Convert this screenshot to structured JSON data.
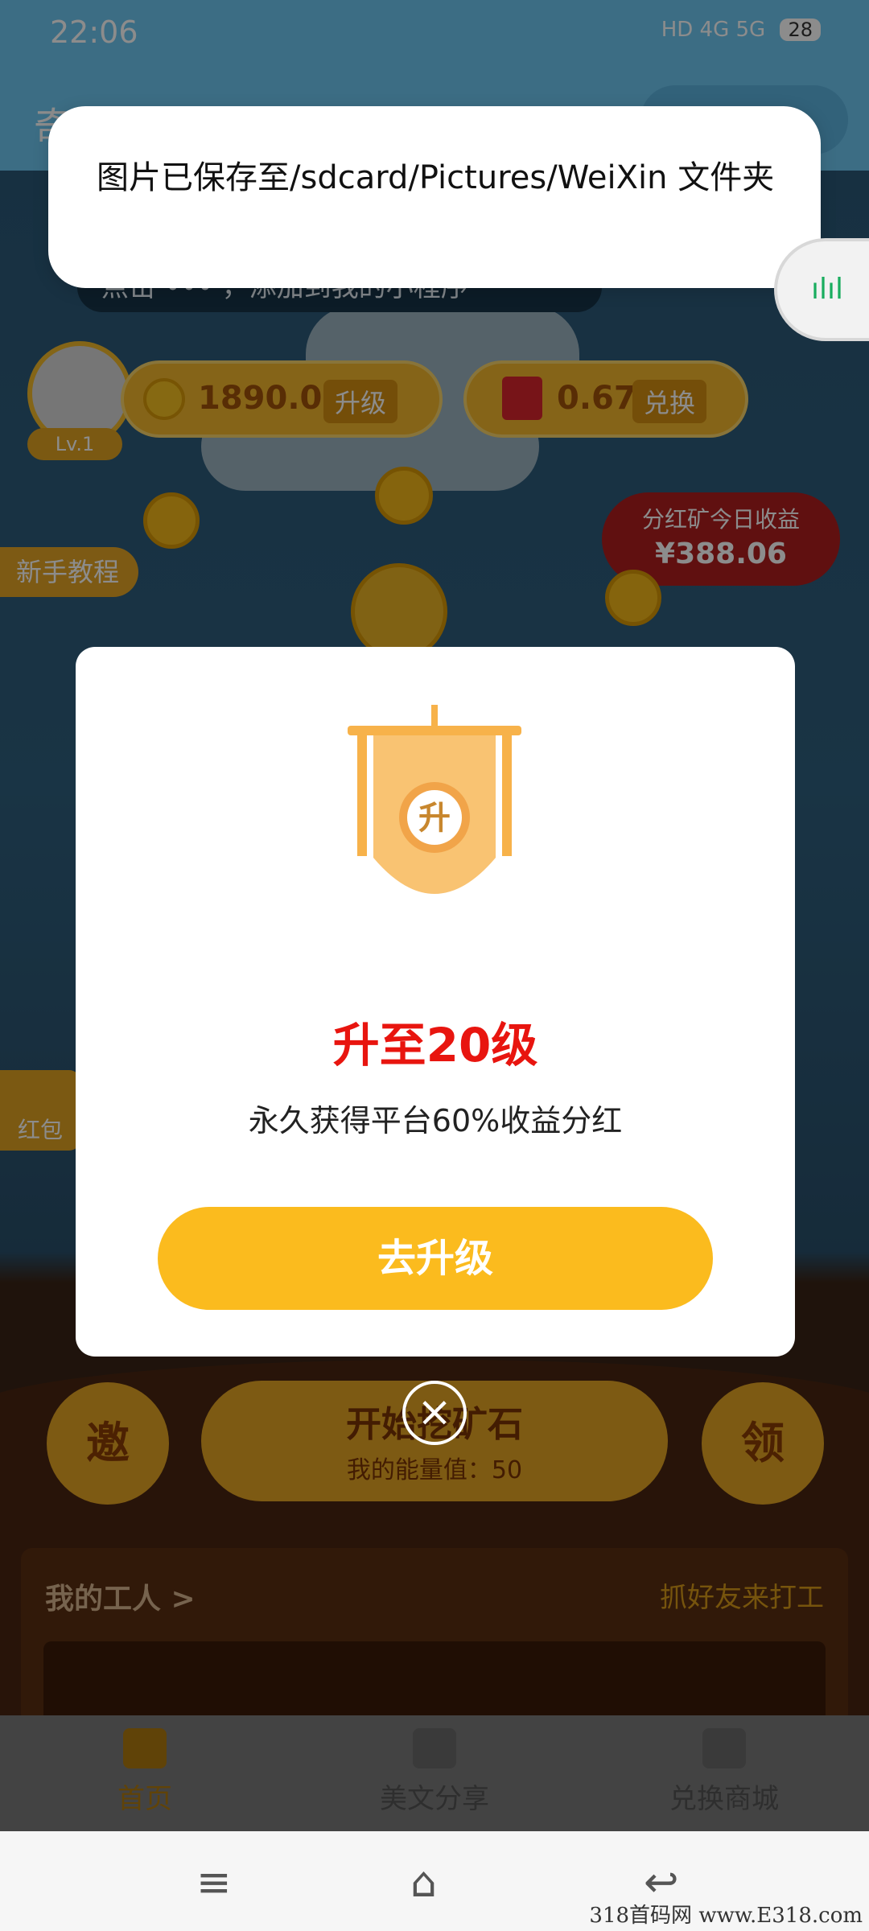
{
  "status_bar": {
    "time": "22:06",
    "network": "HD 4G 5G",
    "battery": "28"
  },
  "app": {
    "title": "奇...",
    "bg_color": "#6ec6f0"
  },
  "scene": {
    "mini_program_hint": "点击 ••• ，添加到我的小程序",
    "level": "Lv.1",
    "coins": "1890.00",
    "upgrade_label": "升级",
    "red_packet": "0.67",
    "exchange_label": "兑换",
    "tutorial": "新手教程",
    "mine_badge": {
      "title": "分红矿今日收益",
      "value": "¥388.06"
    },
    "red_packet_side": "红包",
    "invite": "邀",
    "claim": "领",
    "mine_button": {
      "title": "开始挖矿石",
      "subtitle": "我的能量值：50"
    },
    "workers": {
      "title": "我的工人 >",
      "link": "抓好友来打工"
    }
  },
  "toast": {
    "text": "图片已保存至/sdcard/Pictures/WeiXin 文件夹"
  },
  "modal": {
    "badge_char": "升",
    "title": "升至20级",
    "description": "永久获得平台60%收益分红",
    "cta": "去升级",
    "accent": "#e8150f",
    "button_color": "#fbbb1e"
  },
  "bottom_nav": [
    {
      "label": "首页",
      "icon": "home-icon",
      "active": true
    },
    {
      "label": "美文分享",
      "icon": "article-icon",
      "active": false
    },
    {
      "label": "兑换商城",
      "icon": "store-icon",
      "active": false
    }
  ],
  "system_nav": {
    "menu": "≡",
    "home": "⌂",
    "back": "↩"
  },
  "watermark": "318首码网 www.E318.com"
}
